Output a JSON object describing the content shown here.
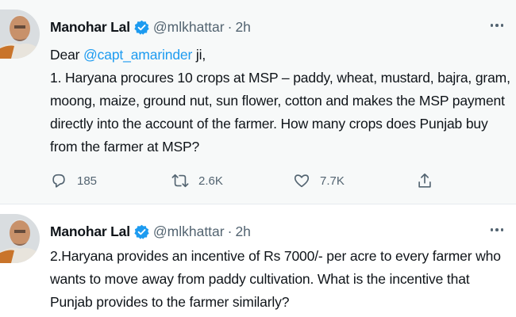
{
  "tweets": [
    {
      "author_name": "Manohar Lal",
      "handle": "@mlkhattar",
      "separator": "·",
      "time": "2h",
      "text_prefix": "Dear ",
      "mention": "@capt_amarinder",
      "text_suffix": " ji,",
      "line2": "1. Haryana procures 10 crops at MSP – paddy, wheat, mustard, bajra, gram,",
      "line3": "moong, maize, ground nut, sun flower, cotton and makes the MSP payment",
      "line4": "directly into the account of the farmer. How many crops does Punjab buy",
      "line5": "from the farmer at MSP?",
      "reply_count": "185",
      "retweet_count": "2.6K",
      "like_count": "7.7K"
    },
    {
      "author_name": "Manohar Lal",
      "handle": "@mlkhattar",
      "separator": "·",
      "time": "2h",
      "line1": "2.Haryana provides an incentive of Rs 7000/- per acre to every farmer who",
      "line2": "wants to move away from paddy cultivation. What is the incentive that",
      "line3": "Punjab provides to the farmer similarly?"
    }
  ],
  "colors": {
    "accent": "#1d9bf0",
    "secondary_text": "#536471",
    "primary_text": "#0f1419",
    "tweet1_background": "#f7f9f9"
  },
  "icons": [
    "verified-badge-icon",
    "more-options-icon",
    "reply-icon",
    "retweet-icon",
    "like-icon",
    "share-icon"
  ]
}
